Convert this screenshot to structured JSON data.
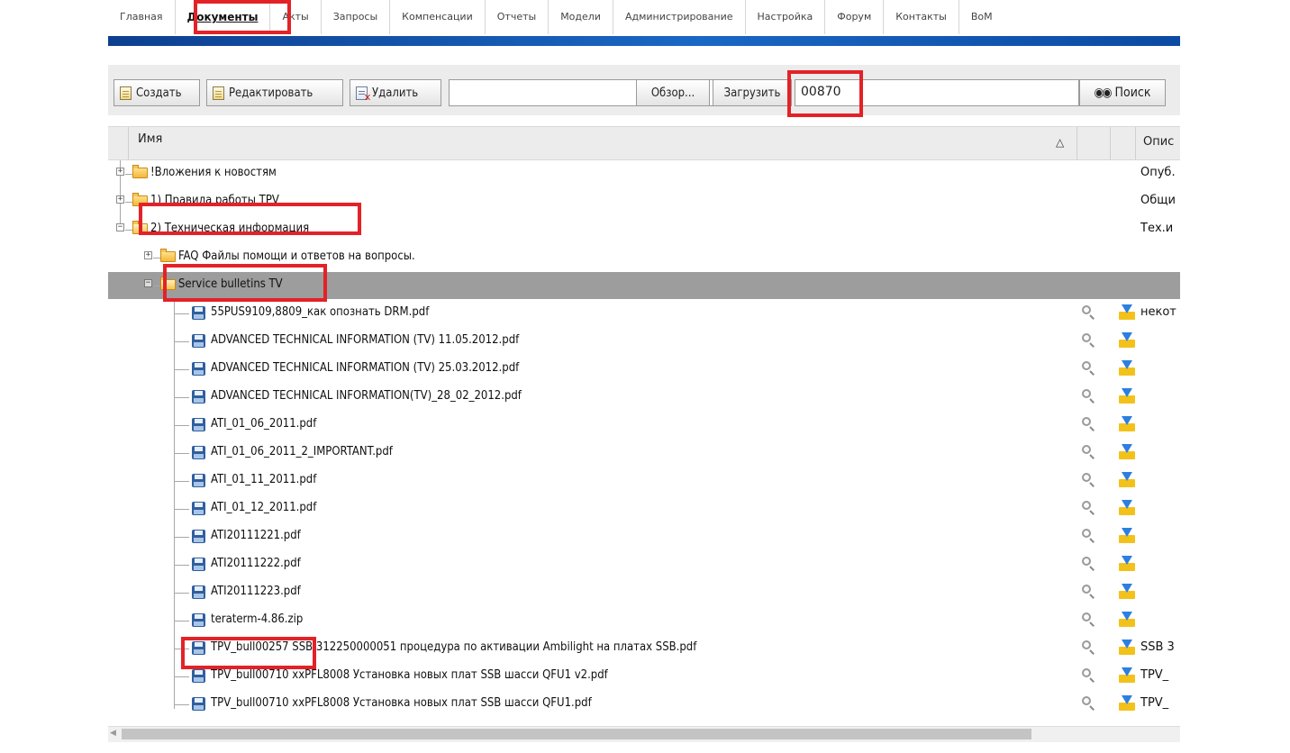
{
  "nav": {
    "tabs": [
      "Главная",
      "Документы",
      "Акты",
      "Запросы",
      "Компенсации",
      "Отчеты",
      "Модели",
      "Администрирование",
      "Настройка",
      "Форум",
      "Контакты",
      "BoM"
    ],
    "active_index": 1
  },
  "toolbar": {
    "create_label": "Создать",
    "edit_label": "Редактировать",
    "delete_label": "Удалить",
    "file_value": "",
    "browse_label": "Обзор...",
    "upload_label": "Загрузить",
    "search_value": "00870",
    "search_label": "Поиск"
  },
  "grid": {
    "name_header": "Имя",
    "sort_indicator": "△",
    "desc_header": "Опис"
  },
  "tree": {
    "rows": [
      {
        "label": "!Вложения к новостям",
        "type": "folder",
        "level": 0,
        "expander": "+",
        "desc": "Опуб."
      },
      {
        "label": "1) Правила работы TPV",
        "type": "folder",
        "level": 0,
        "expander": "+",
        "desc": "Общи"
      },
      {
        "label": "2) Техническая информация",
        "type": "folder",
        "level": 0,
        "expander": "−",
        "desc": "Тех.и"
      },
      {
        "label": "FAQ Файлы помощи и ответов на вопросы.",
        "type": "folder",
        "level": 1,
        "expander": "+",
        "desc": ""
      },
      {
        "label": "Service bulletins TV",
        "type": "folder",
        "level": 1,
        "expander": "−",
        "desc": "",
        "selected": true
      },
      {
        "label": "55PUS9109,8809_как опознать DRM.pdf",
        "type": "file",
        "level": 2,
        "desc": "некот"
      },
      {
        "label": "ADVANCED TECHNICAL INFORMATION (TV) 11.05.2012.pdf",
        "type": "file",
        "level": 2,
        "desc": ""
      },
      {
        "label": "ADVANCED TECHNICAL INFORMATION (TV) 25.03.2012.pdf",
        "type": "file",
        "level": 2,
        "desc": ""
      },
      {
        "label": "ADVANCED TECHNICAL INFORMATION(TV)_28_02_2012.pdf",
        "type": "file",
        "level": 2,
        "desc": ""
      },
      {
        "label": "ATI_01_06_2011.pdf",
        "type": "file",
        "level": 2,
        "desc": ""
      },
      {
        "label": "ATI_01_06_2011_2_IMPORTANT.pdf",
        "type": "file",
        "level": 2,
        "desc": ""
      },
      {
        "label": "ATI_01_11_2011.pdf",
        "type": "file",
        "level": 2,
        "desc": ""
      },
      {
        "label": "ATI_01_12_2011.pdf",
        "type": "file",
        "level": 2,
        "desc": ""
      },
      {
        "label": "ATI20111221.pdf",
        "type": "file",
        "level": 2,
        "desc": ""
      },
      {
        "label": "ATI20111222.pdf",
        "type": "file",
        "level": 2,
        "desc": ""
      },
      {
        "label": "ATI20111223.pdf",
        "type": "file",
        "level": 2,
        "desc": ""
      },
      {
        "label": "teraterm-4.86.zip",
        "type": "file",
        "level": 2,
        "desc": ""
      },
      {
        "label": "TPV_bull00257 SSB 312250000051 процедура по активации Ambilight на платах SSB.pdf",
        "type": "file",
        "level": 2,
        "desc": "SSB 3"
      },
      {
        "label": "TPV_bull00710 xxPFL8008 Установка новых плат SSB шасси QFU1 v2.pdf",
        "type": "file",
        "level": 2,
        "desc": "TPV_"
      },
      {
        "label": "TPV_bull00710 xxPFL8008 Установка новых плат SSB шасси QFU1.pdf",
        "type": "file",
        "level": 2,
        "desc": "TPV_"
      }
    ]
  },
  "colors": {
    "highlight": "#e32228",
    "nav_bar": "#1a67c4",
    "selected_row": "#9d9d9d"
  }
}
